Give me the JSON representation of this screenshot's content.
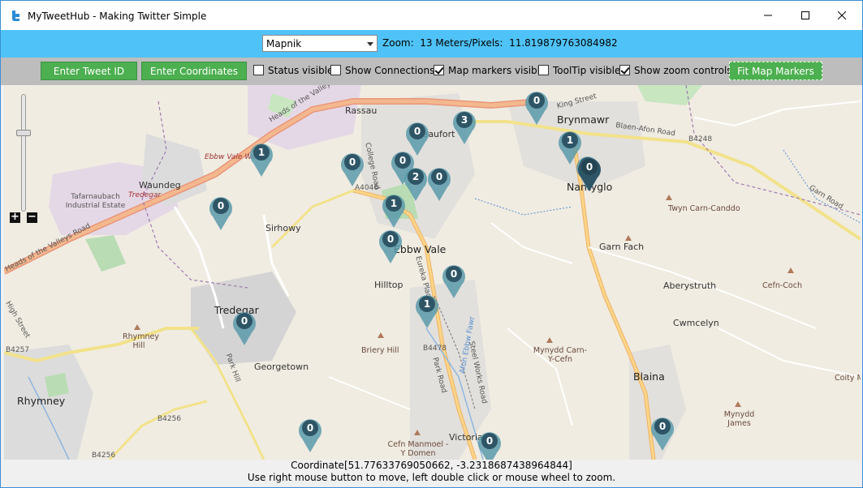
{
  "window": {
    "title": "MyTweetHub - Making Twitter Simple",
    "minimize_icon": "minimize-icon",
    "maximize_icon": "maximize-icon",
    "close_icon": "close-icon"
  },
  "topbar": {
    "tile_source": "Mapnik",
    "zoom_text": "Zoom:  13 Meters/Pixels:  11.819879763084982",
    "bg_color": "#4fc3f7"
  },
  "toolbar": {
    "enter_tweet_id": "Enter Tweet ID",
    "enter_coordinates": "Enter Coordinates",
    "status_visible": {
      "label": "Status visible",
      "checked": false
    },
    "show_connections": {
      "label": "Show Connections",
      "checked": false
    },
    "map_markers_visible": {
      "label": "Map markers visible",
      "checked": true
    },
    "tooltip_visible": {
      "label": "ToolTip visible",
      "checked": false
    },
    "show_zoom_controls": {
      "label": "Show zoom controls",
      "checked": true
    },
    "fit_map_markers": "Fit Map Markers",
    "button_color": "#4caf50"
  },
  "map": {
    "places": [
      {
        "name": "Rassau",
        "kind": "normal"
      },
      {
        "name": "Beaufort",
        "kind": "normal"
      },
      {
        "name": "Brynmawr",
        "kind": "big"
      },
      {
        "name": "Nantyglo",
        "kind": "big"
      },
      {
        "name": "Ebbw Vale West",
        "kind": "red"
      },
      {
        "name": "Waundeg",
        "kind": "normal"
      },
      {
        "name": "Tredegar",
        "kind": "red"
      },
      {
        "name": "Tafarnaubach Industrial Estate",
        "kind": "small"
      },
      {
        "name": "Sirhowy",
        "kind": "normal"
      },
      {
        "name": "Ebbw Vale",
        "kind": "big"
      },
      {
        "name": "Hilltop",
        "kind": "normal"
      },
      {
        "name": "Tredegar",
        "kind": "big"
      },
      {
        "name": "Rhymney Hill",
        "kind": "hill"
      },
      {
        "name": "Georgetown",
        "kind": "normal"
      },
      {
        "name": "Briery Hill",
        "kind": "hill"
      },
      {
        "name": "Mynydd Carn-Y-Cefn",
        "kind": "hill"
      },
      {
        "name": "Blaina",
        "kind": "big"
      },
      {
        "name": "Rhymney",
        "kind": "big"
      },
      {
        "name": "Cefn Manmoel - Y Domen",
        "kind": "hill"
      },
      {
        "name": "Victoria",
        "kind": "normal"
      },
      {
        "name": "Twyn Carn-Canddo",
        "kind": "hill"
      },
      {
        "name": "Garn Fach",
        "kind": "normal"
      },
      {
        "name": "Aberystruth",
        "kind": "normal"
      },
      {
        "name": "Cefn-Coch",
        "kind": "hill"
      },
      {
        "name": "Cwmcelyn",
        "kind": "normal"
      },
      {
        "name": "Mynydd James",
        "kind": "hill"
      },
      {
        "name": "Coity M",
        "kind": "hill"
      },
      {
        "name": "Heads of the Valleys Road",
        "kind": "small"
      },
      {
        "name": "Heads of the Valleys Road",
        "kind": "small"
      },
      {
        "name": "A4046",
        "kind": "small"
      },
      {
        "name": "B4478",
        "kind": "small"
      },
      {
        "name": "B4257",
        "kind": "small"
      },
      {
        "name": "B4256",
        "kind": "small"
      },
      {
        "name": "B4248",
        "kind": "small"
      },
      {
        "name": "Blaen-Afon Road",
        "kind": "small"
      },
      {
        "name": "Garn Road",
        "kind": "small"
      },
      {
        "name": "College Road",
        "kind": "small"
      },
      {
        "name": "Eureka Place",
        "kind": "small"
      },
      {
        "name": "Park Road",
        "kind": "small"
      },
      {
        "name": "Steel Works Road",
        "kind": "small"
      },
      {
        "name": "High Street",
        "kind": "small"
      },
      {
        "name": "Park Hill",
        "kind": "small"
      },
      {
        "name": "King Street",
        "kind": "small"
      },
      {
        "name": "Afon Ebbw Fawr",
        "kind": "small"
      },
      {
        "name": "B4256",
        "kind": "small"
      }
    ],
    "markers": [
      "1",
      "0",
      "0",
      "0",
      "0",
      "3",
      "0",
      "2",
      "0",
      "1",
      "0",
      "0",
      "0",
      "1",
      "0",
      "0",
      "0",
      "0",
      "1",
      "0",
      "0"
    ]
  },
  "zoom_controls": {
    "plus": "+",
    "minus": "−"
  },
  "status": {
    "coordinate": "Coordinate[51.77633769050662, -3.2318687438964844]",
    "hint": "Use right mouse button to move, left double click or mouse wheel to zoom."
  }
}
